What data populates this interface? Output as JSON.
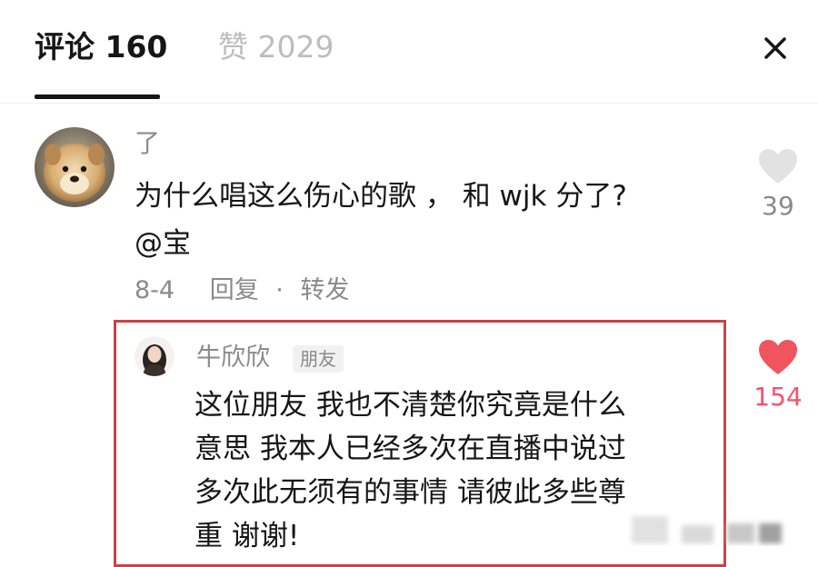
{
  "tabs": {
    "comments_label": "评论 160",
    "likes_label": "赞 2029"
  },
  "comment": {
    "username": "了",
    "text_line1": "为什么唱这么伤心的歌 ， 和 wjk 分了?",
    "text_line2": "@宝",
    "date": "8-4",
    "reply_label": "回复",
    "separator": "·",
    "share_label": "转发",
    "like_count": "39"
  },
  "reply": {
    "username": "牛欣欣",
    "badge": "朋友",
    "text_line1": "这位朋友 我也不清楚你究竟是什么",
    "text_line2": "意思 我本人已经多次在直播中说过",
    "text_line3": "多次此无须有的事情 请彼此多些尊",
    "text_line4": "重 谢谢!",
    "like_count": "154"
  },
  "colors": {
    "liked": "#f0555f",
    "unliked": "#e2e2e2",
    "highlight_border": "#c94446"
  },
  "icons": {
    "close": "close-icon",
    "heart": "heart-icon"
  }
}
